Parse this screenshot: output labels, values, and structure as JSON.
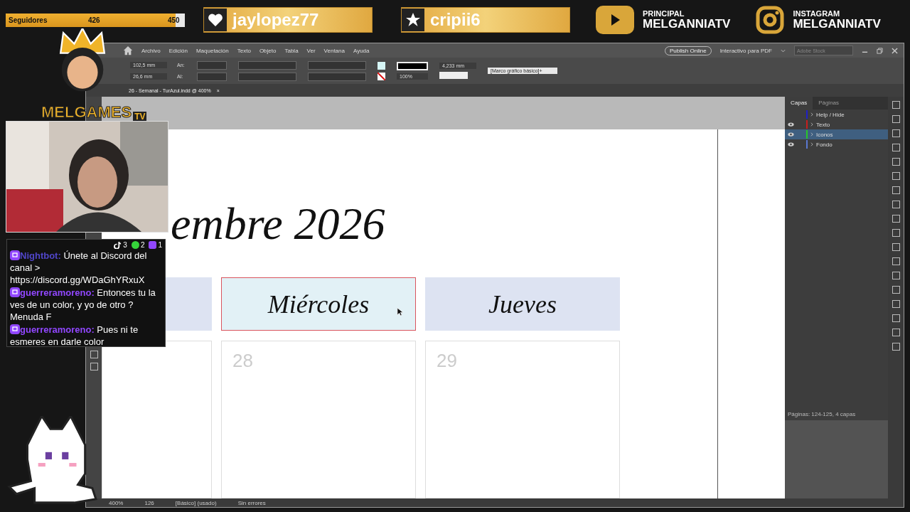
{
  "followers": {
    "label": "Seguidores",
    "count": "426",
    "goal": "450",
    "level": 0.947
  },
  "alerts": [
    {
      "kind": "heart",
      "name": "jaylopez77"
    },
    {
      "kind": "star",
      "name": "cripii6"
    }
  ],
  "socials": [
    {
      "kind": "youtube",
      "label": "PRINCIPAL",
      "handle": "MELGANNIATV"
    },
    {
      "kind": "instagram",
      "label": "INSTAGRAM",
      "handle": "MELGANNIATV"
    }
  ],
  "mascot": {
    "brand": "MELGAMES",
    "badge": "TV"
  },
  "app": {
    "menu": [
      "Archivo",
      "Edición",
      "Maquetación",
      "Texto",
      "Objeto",
      "Tabla",
      "Ver",
      "Ventana",
      "Ayuda"
    ],
    "publish": "Publish Online",
    "workspace": "Interactivo para PDF",
    "search": {
      "placeholder": "Adobe Stock"
    },
    "control": {
      "width_value": "102,5 mm",
      "width_label": "An:",
      "height_value": "26,6 mm",
      "height_label": "Al:",
      "stroke": "4,233 mm",
      "style": "[Marco gráfico básico]+",
      "scale": "100%"
    },
    "document_tab": {
      "title": "26 - Semanal - TurAzul.indd @ 400%",
      "close": "×"
    },
    "page": {
      "title": "embre 2026",
      "days": [
        {
          "name": "Miércoles",
          "date": "28",
          "selected": true
        },
        {
          "name": "Jueves",
          "date": "29",
          "selected": false
        }
      ]
    },
    "layers_panel": {
      "tabs": [
        {
          "label": "Capas",
          "selected": true
        },
        {
          "label": "Páginas",
          "selected": false
        }
      ],
      "layers": [
        {
          "name": "Help / Hide",
          "color": "#2020c8",
          "visible": false,
          "selected": false
        },
        {
          "name": "Texto",
          "color": "#c81e1e",
          "visible": true,
          "selected": false
        },
        {
          "name": "Iconos",
          "color": "#28c828",
          "visible": true,
          "selected": true
        },
        {
          "name": "Fondo",
          "color": "#5a78d2",
          "visible": true,
          "selected": false
        }
      ],
      "footer": "Páginas: 124-125, 4 capas"
    },
    "status_bar": {
      "zoom": "400%",
      "page": "126",
      "style": "[Básico] (usado)",
      "preflight": "Sin errores"
    }
  },
  "chat": {
    "counts": [
      {
        "kind": "tiktok",
        "count": "3"
      },
      {
        "kind": "kick",
        "count": "2"
      },
      {
        "kind": "twitch",
        "count": "1"
      }
    ],
    "messages": [
      {
        "user": "Nightbot:",
        "color": "#5046c8",
        "text": "Únete al Discord del canal > https://discord.gg/WDaGhYRxuX"
      },
      {
        "user": "guerreramoreno:",
        "color": "#9147ff",
        "text": "Entonces tu la ves de un color, y yo de otro ? Menuda F"
      },
      {
        "user": "guerreramoreno:",
        "color": "#9147ff",
        "text": "Pues ni te esmeres en darle color"
      }
    ]
  }
}
